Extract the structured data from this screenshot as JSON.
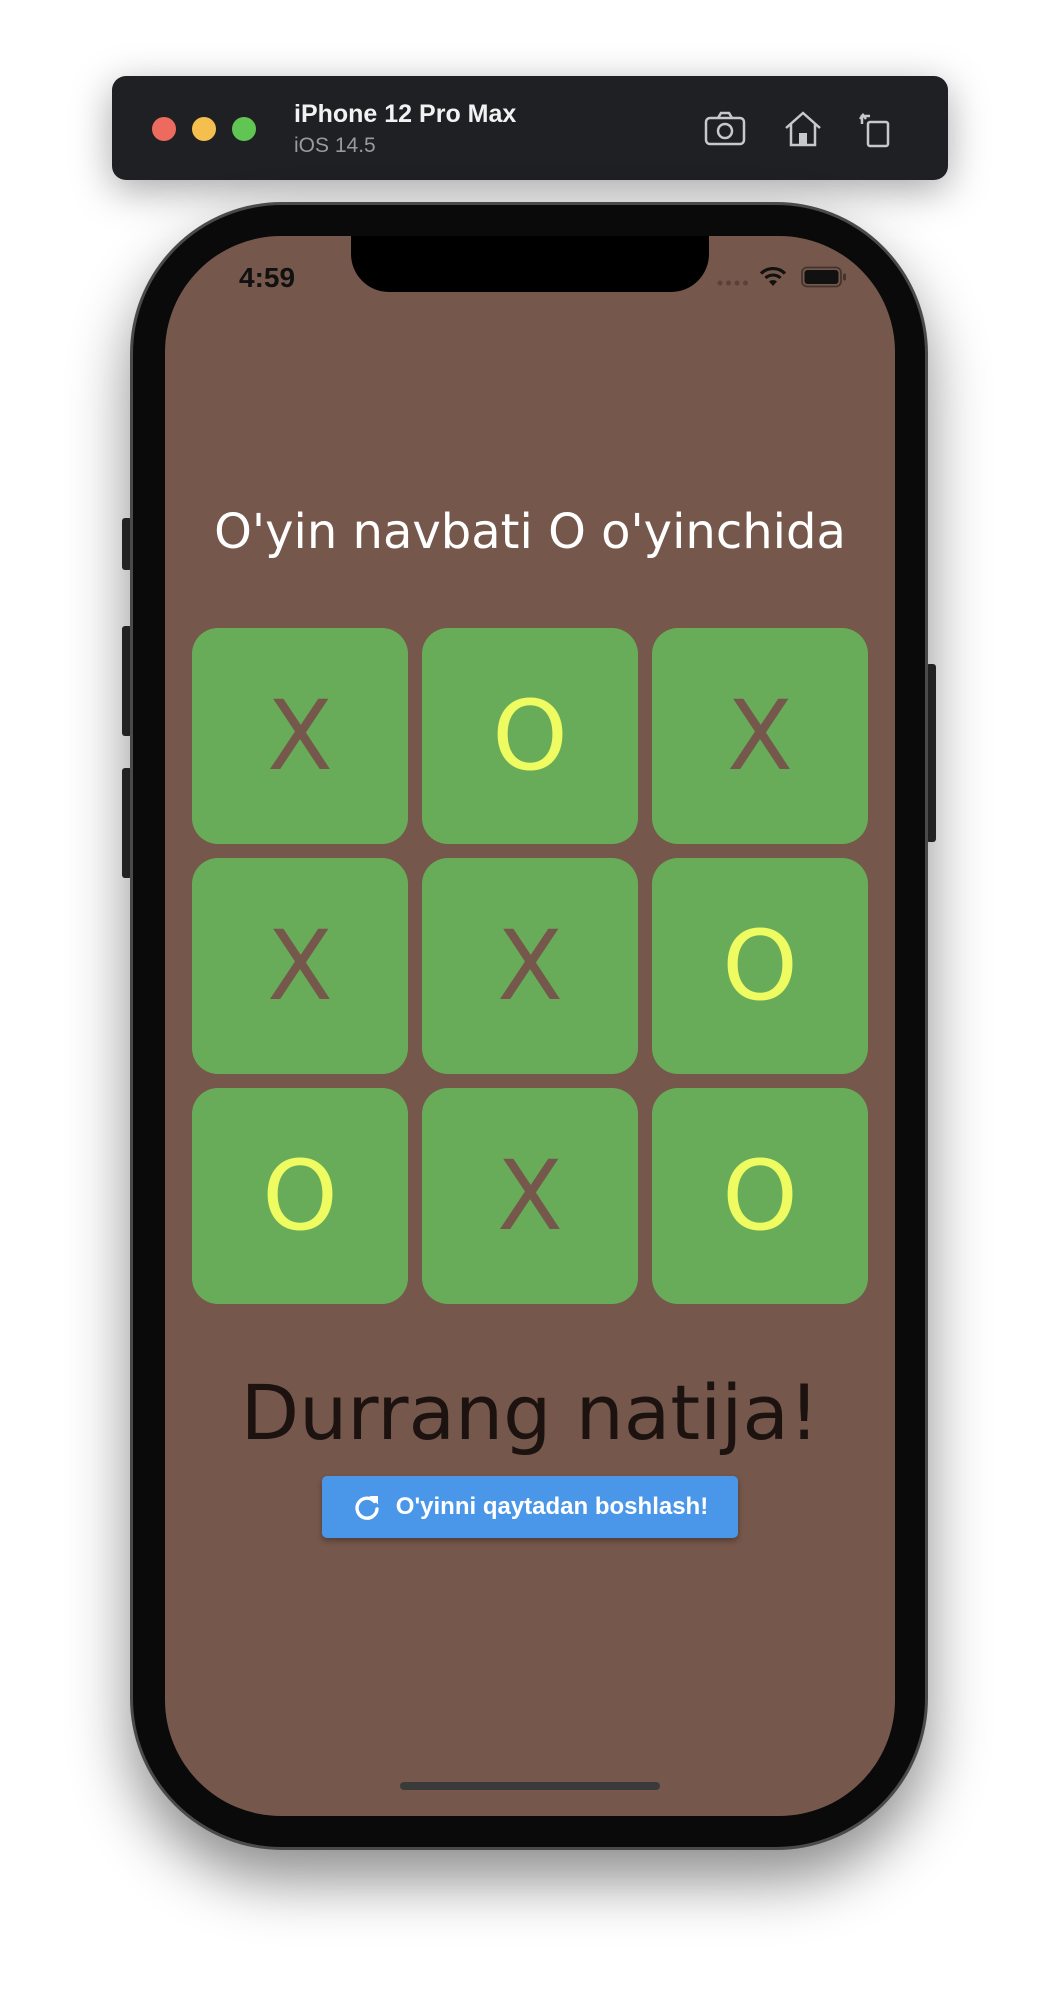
{
  "simulator": {
    "device_name": "iPhone 12 Pro Max",
    "os_version": "iOS 14.5",
    "icons": [
      "screenshot-icon",
      "home-icon",
      "rotate-icon"
    ]
  },
  "status_bar": {
    "time": "4:59",
    "icons": [
      "signal-icon",
      "wifi-icon",
      "battery-icon"
    ]
  },
  "game": {
    "turn_text": "O'yin navbati O o'yinchida",
    "board": [
      "X",
      "O",
      "X",
      "X",
      "X",
      "O",
      "O",
      "X",
      "O"
    ],
    "result_text": "Durrang natija!",
    "restart_label": "O'yinni qaytadan boshlash!",
    "restart_icon": "refresh-icon"
  },
  "colors": {
    "background": "#76574b",
    "cell": "#68ac5a",
    "mark_x": "#76574b",
    "mark_o": "#eefb61",
    "button": "#4a97ea"
  }
}
